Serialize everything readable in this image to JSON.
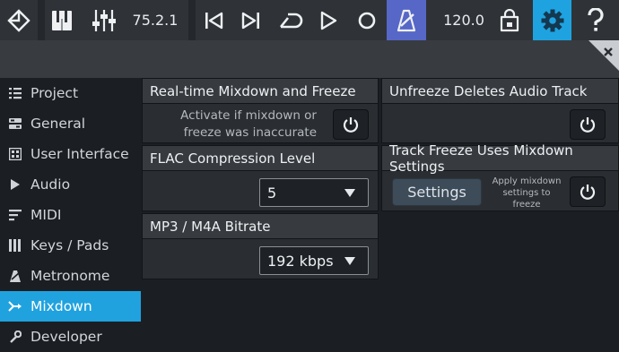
{
  "toolbar": {
    "version": "75.2.1",
    "tempo": "120.0"
  },
  "sidebar": {
    "items": [
      {
        "label": "Project"
      },
      {
        "label": "General"
      },
      {
        "label": "User Interface"
      },
      {
        "label": "Audio"
      },
      {
        "label": "MIDI"
      },
      {
        "label": "Keys / Pads"
      },
      {
        "label": "Metronome"
      },
      {
        "label": "Mixdown"
      },
      {
        "label": "Developer"
      }
    ],
    "active": "Mixdown"
  },
  "panels": {
    "realtime": {
      "title": "Real-time Mixdown and Freeze",
      "note_line1": "Activate if mixdown or",
      "note_line2": "freeze was inaccurate"
    },
    "unfreeze": {
      "title": "Unfreeze Deletes Audio Track"
    },
    "flac": {
      "title": "FLAC Compression Level",
      "value": "5"
    },
    "track_freeze": {
      "title": "Track Freeze Uses Mixdown Settings",
      "button_label": "Settings",
      "note_line1": "Apply mixdown",
      "note_line2": "settings to",
      "note_line3": "freeze"
    },
    "mp3": {
      "title": "MP3 / M4A Bitrate",
      "value": "192 kbps"
    }
  },
  "colors": {
    "accent": "#20a2df",
    "metronome_active": "#5667c7"
  }
}
